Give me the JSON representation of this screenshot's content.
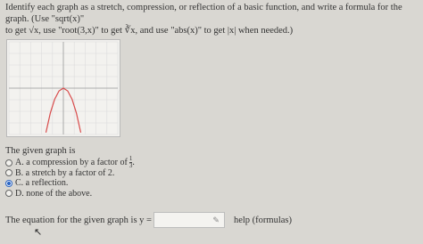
{
  "instructions": {
    "line1": "Identify each graph as a stretch, compression, or reflection of a basic function, and write a formula for the graph. (Use \"sqrt(x)\"",
    "line2": "to get √x, use \"root(3,x)\" to get ∛x, and use \"abs(x)\" to get |x| when needed.)"
  },
  "question": "The given graph is",
  "choices": [
    {
      "letter": "A.",
      "text": "a compression by a factor of",
      "fraction": {
        "num": "1",
        "den": "3"
      },
      "suffix": ".",
      "selected": false
    },
    {
      "letter": "B.",
      "text": "a stretch by a factor of 2.",
      "selected": false
    },
    {
      "letter": "C.",
      "text": "a reflection.",
      "selected": true
    },
    {
      "letter": "D.",
      "text": "none of the above.",
      "selected": false
    }
  ],
  "answer": {
    "prompt": "The equation for the given graph is y =",
    "value": "",
    "help_text": "help (formulas)"
  },
  "colors": {
    "curve": "#d84b4b",
    "selected": "#2c66c3",
    "grid": "#dcdcdc"
  },
  "chart_data": {
    "type": "line",
    "series": [
      {
        "x": [
          -1.6,
          -1.2,
          -0.8,
          -0.4,
          0,
          0.4,
          0.8,
          1.2,
          1.6
        ],
        "y": [
          -7.68,
          -4.32,
          -1.92,
          -0.48,
          0,
          -0.48,
          -1.92,
          -4.32,
          -7.68
        ]
      }
    ],
    "xlim": [
      -5,
      5
    ],
    "ylim": [
      -8,
      8
    ],
    "grid": true
  }
}
